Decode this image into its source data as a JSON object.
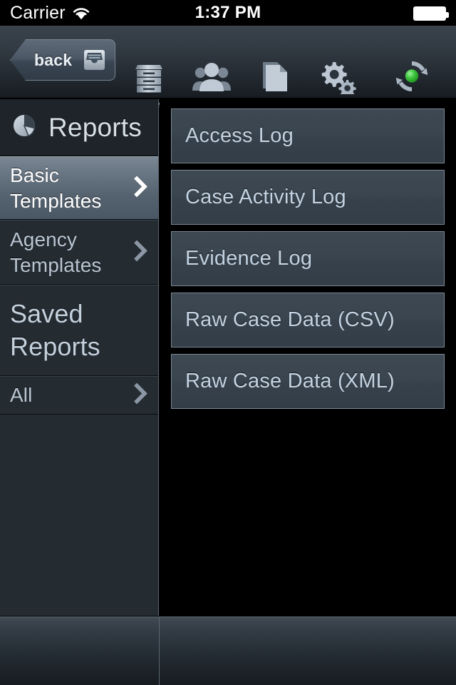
{
  "status_bar": {
    "carrier": "Carrier",
    "wifi_icon": "wifi-icon",
    "time": "1:37 PM",
    "battery_icon": "battery-full-icon"
  },
  "toolbar": {
    "back_label": "back",
    "back_icon": "inbox-tray-icon",
    "items": [
      {
        "label": "Cases",
        "icon": "filing-cabinet-icon"
      },
      {
        "label": "People",
        "icon": "people-group-icon"
      },
      {
        "label": "Files",
        "icon": "documents-icon"
      },
      {
        "label": "Settings",
        "icon": "gears-icon"
      },
      {
        "label": "Sync",
        "icon": "sync-circular-arrows-icon"
      }
    ]
  },
  "sidebar": {
    "header": {
      "title": "Reports",
      "icon": "pie-chart-icon"
    },
    "rows": [
      {
        "label": "Basic\nTemplates",
        "selected": true,
        "chevron": true,
        "type": "row"
      },
      {
        "label": "Agency\nTemplates",
        "selected": false,
        "chevron": true,
        "type": "row"
      },
      {
        "label": "Saved\nReports",
        "selected": false,
        "chevron": false,
        "type": "section"
      },
      {
        "label": "All",
        "selected": false,
        "chevron": true,
        "type": "row"
      }
    ]
  },
  "main": {
    "report_buttons": [
      {
        "label": "Access Log"
      },
      {
        "label": "Case Activity Log"
      },
      {
        "label": "Evidence Log"
      },
      {
        "label": "Raw Case Data (CSV)"
      },
      {
        "label": "Raw Case Data (XML)"
      }
    ]
  },
  "colors": {
    "background": "#000000",
    "toolbar_top": "#3a424b",
    "sidebar_bg": "#242b31",
    "selected_row": "#6b7885",
    "button_face": "#3a454f",
    "button_border": "#7b8893",
    "text_primary": "#c4d3e2",
    "text_muted": "#98a3ae",
    "sync_green": "#3cc83c"
  }
}
